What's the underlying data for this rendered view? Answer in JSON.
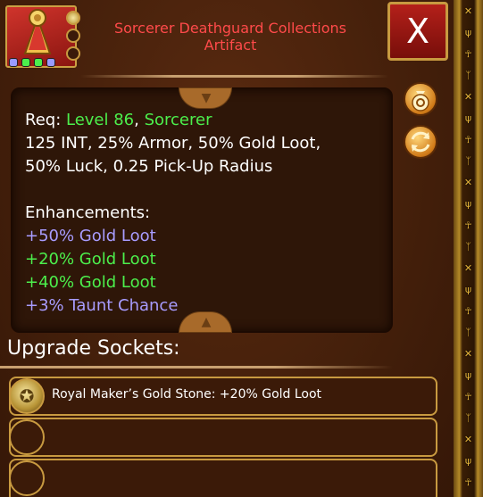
{
  "header": {
    "title_line1": "Sorcerer Deathguard Collections",
    "title_line2": "Artifact",
    "close_label": "X"
  },
  "item_icon": {
    "icon": "artifact-necklace-icon",
    "gem_colors": [
      "#9a9aff",
      "#4cef4c",
      "#4cef4c",
      "#9a9aff"
    ]
  },
  "stats": {
    "req_label": "Req: ",
    "req_level": "Level 86",
    "req_sep": ", ",
    "req_class": "Sorcerer",
    "stat_line1": "125 INT, 25% Armor, 50% Gold Loot,",
    "stat_line2": "50% Luck, 0.25 Pick-Up Radius",
    "enhancements_header": "Enhancements:",
    "enhancements": [
      {
        "text": "+50% Gold Loot",
        "color": "purple"
      },
      {
        "text": "+20% Gold Loot",
        "color": "green"
      },
      {
        "text": "+40% Gold Loot",
        "color": "green"
      },
      {
        "text": "+3% Taunt Chance",
        "color": "purple"
      }
    ]
  },
  "side_buttons": {
    "sell_icon": "gold-bag-icon",
    "transmute_icon": "swap-arrows-icon"
  },
  "sockets": {
    "title": "Upgrade Sockets:",
    "slots": [
      {
        "label": "Royal Maker’s Gold Stone: +20% Gold Loot",
        "filled": true
      },
      {
        "label": "",
        "filled": false
      },
      {
        "label": "",
        "filled": false
      }
    ]
  },
  "colors": {
    "title_red": "#ff4a4a",
    "green": "#4cef4c",
    "purple": "#a89cff",
    "gold_border": "#c89a40"
  }
}
